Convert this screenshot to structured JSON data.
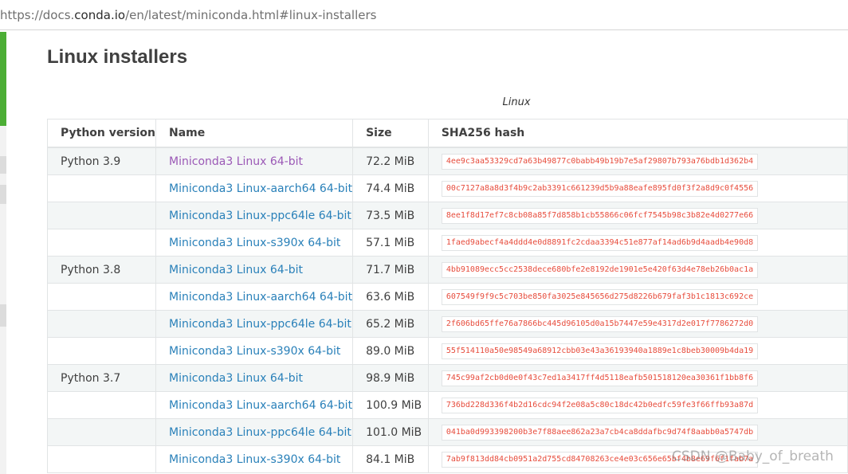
{
  "browser": {
    "url_prefix": "https://docs.",
    "url_domain": "conda.io",
    "url_path": "/en/latest/miniconda.html#linux-installers"
  },
  "page": {
    "title": "Linux installers",
    "caption": "Linux"
  },
  "table": {
    "headers": {
      "python_version": "Python version",
      "name": "Name",
      "size": "Size",
      "hash": "SHA256 hash"
    },
    "rows": [
      {
        "python": "Python 3.9",
        "name": "Miniconda3 Linux 64-bit",
        "size": "72.2 MiB",
        "hash": "4ee9c3aa53329cd7a63b49877c0babb49b19b7e5af29807b793a76bdb1d362b4",
        "visited": true
      },
      {
        "python": "",
        "name": "Miniconda3 Linux-aarch64 64-bit",
        "size": "74.4 MiB",
        "hash": "00c7127a8a8d3f4b9c2ab3391c661239d5b9a88eafe895fd0f3f2a8d9c0f4556",
        "visited": false
      },
      {
        "python": "",
        "name": "Miniconda3 Linux-ppc64le 64-bit",
        "size": "73.5 MiB",
        "hash": "8ee1f8d17ef7c8cb08a85f7d858b1cb55866c06fcf7545b98c3b82e4d0277e66",
        "visited": false
      },
      {
        "python": "",
        "name": "Miniconda3 Linux-s390x 64-bit",
        "size": "57.1 MiB",
        "hash": "1faed9abecf4a4ddd4e0d8891fc2cdaa3394c51e877af14ad6b9d4aadb4e90d8",
        "visited": false
      },
      {
        "python": "Python 3.8",
        "name": "Miniconda3 Linux 64-bit",
        "size": "71.7 MiB",
        "hash": "4bb91089ecc5cc2538dece680bfe2e8192de1901e5e420f63d4e78eb26b0ac1a",
        "visited": false
      },
      {
        "python": "",
        "name": "Miniconda3 Linux-aarch64 64-bit",
        "size": "63.6 MiB",
        "hash": "607549f9f9c5c703be850fa3025e845656d275d8226b679faf3b1c1813c692ce",
        "visited": false
      },
      {
        "python": "",
        "name": "Miniconda3 Linux-ppc64le 64-bit",
        "size": "65.2 MiB",
        "hash": "2f606bd65ffe76a7866bc445d96105d0a15b7447e59e4317d2e017f7786272d0",
        "visited": false
      },
      {
        "python": "",
        "name": "Miniconda3 Linux-s390x 64-bit",
        "size": "89.0 MiB",
        "hash": "55f514110a50e98549a68912cbb03e43a36193940a1889e1c8beb30009b4da19",
        "visited": false
      },
      {
        "python": "Python 3.7",
        "name": "Miniconda3 Linux 64-bit",
        "size": "98.9 MiB",
        "hash": "745c99af2cb0d0e0f43c7ed1a3417ff4d5118eafb501518120ea30361f1bb8f6",
        "visited": false
      },
      {
        "python": "",
        "name": "Miniconda3 Linux-aarch64 64-bit",
        "size": "100.9 MiB",
        "hash": "736bd228d336f4b2d16cdc94f2e08a5c80c18dc42b0edfc59fe3f66ffb93a87d",
        "visited": false
      },
      {
        "python": "",
        "name": "Miniconda3 Linux-ppc64le 64-bit",
        "size": "101.0 MiB",
        "hash": "041ba0d993398200b3e7f88aee862a23a7cb4ca8ddafbc9d74f8aabb0a5747db",
        "visited": false
      },
      {
        "python": "",
        "name": "Miniconda3 Linux-s390x 64-bit",
        "size": "84.1 MiB",
        "hash": "7ab9f813dd84cb0951a2d755cd84708263ce4e03c656e65bf4b8e69f6f1fab7a",
        "visited": false
      }
    ]
  },
  "watermark": "CSDN @Baby_of_breath"
}
